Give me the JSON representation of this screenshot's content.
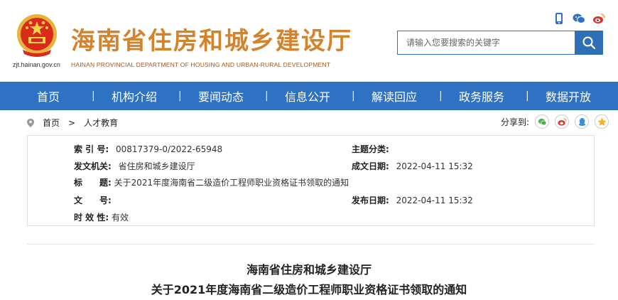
{
  "header": {
    "domain": "zjt.hainan.gov.cn",
    "title": "海南省住房和城乡建设厅",
    "subtitle": "HAINAN PROVINCIAL DEPARTMENT OF HOUSING AND URBAN-RURAL DEVELOPMENT",
    "icons": [
      "mobile-icon",
      "wechat-icon",
      "weibo-icon"
    ],
    "search_placeholder": "请输入您要搜索的关键字"
  },
  "nav": {
    "items": [
      "首页",
      "机构介绍",
      "要闻动态",
      "信息公开",
      "解读回应",
      "政务服务",
      "数据开放"
    ]
  },
  "breadcrumb": {
    "home": "首页",
    "arrow": ">",
    "current": "人才教育"
  },
  "share": {
    "label": "分享到:",
    "icons": [
      "wechat-icon",
      "weibo-icon",
      "qq-icon",
      "qzone-icon"
    ]
  },
  "meta": {
    "index_label": "索 引 号:",
    "index_value": "00817379-0/2022-65948",
    "topic_label": "主题分类:",
    "topic_value": "",
    "issuer_label": "发文机关:",
    "issuer_value": "省住房和城乡建设厅",
    "created_label": "成文日期:",
    "created_value": "2022-04-11 15:32",
    "title_label": "标　　题:",
    "title_value": "关于2021年度海南省二级造价工程师职业资格证书领取的通知",
    "docno_label": "文　　号:",
    "docno_value": "",
    "published_label": "发布日期:",
    "published_value": "2022-04-11 15:32",
    "validity_label": "时 效 性:",
    "validity_value": "有效"
  },
  "article": {
    "title_line1": "海南省住房和城乡建设厅",
    "title_line2": "关于2021年度海南省二级造价工程师职业资格证书领取的通知"
  },
  "colors": {
    "nav_blue": "#2f71c2",
    "title_orange": "#d5832a",
    "emblem_red": "#d92a1c"
  }
}
